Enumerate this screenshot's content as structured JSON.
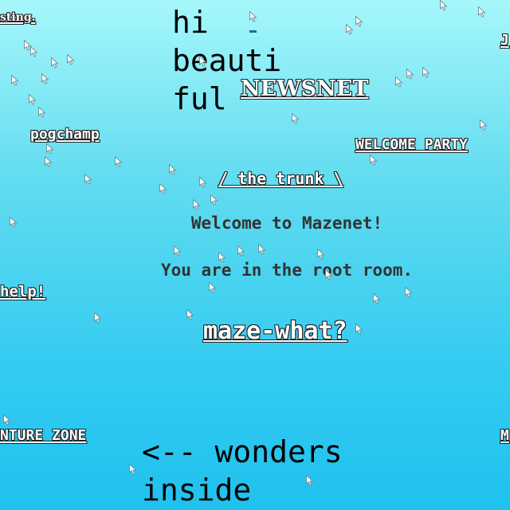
{
  "theme": {
    "link_color": "#ffffff",
    "outline_color": "#222222",
    "heading_color": "#333333",
    "cursor_color": "#ffffff"
  },
  "writing": {
    "hi_line1": "hi",
    "hi_line2": "beauti",
    "hi_line3": "ful",
    "wonders_line1": "<-- wonders",
    "wonders_line2": "inside"
  },
  "room": {
    "welcome": "Welcome to Mazenet!",
    "location": "You are in the root room."
  },
  "links": {
    "testing": "sting.",
    "newsnet": "NEWSNET",
    "pogchamp": "pogchamp",
    "welcome_party": "WELCOME PARTY",
    "the_trunk": "/ the trunk \\",
    "help": "help!",
    "maze_what": "maze-what?",
    "adventure_zone": "NTURE ZONE",
    "right_j": "J",
    "right_m": "M"
  },
  "cursors": [
    "cursor-icon"
  ]
}
